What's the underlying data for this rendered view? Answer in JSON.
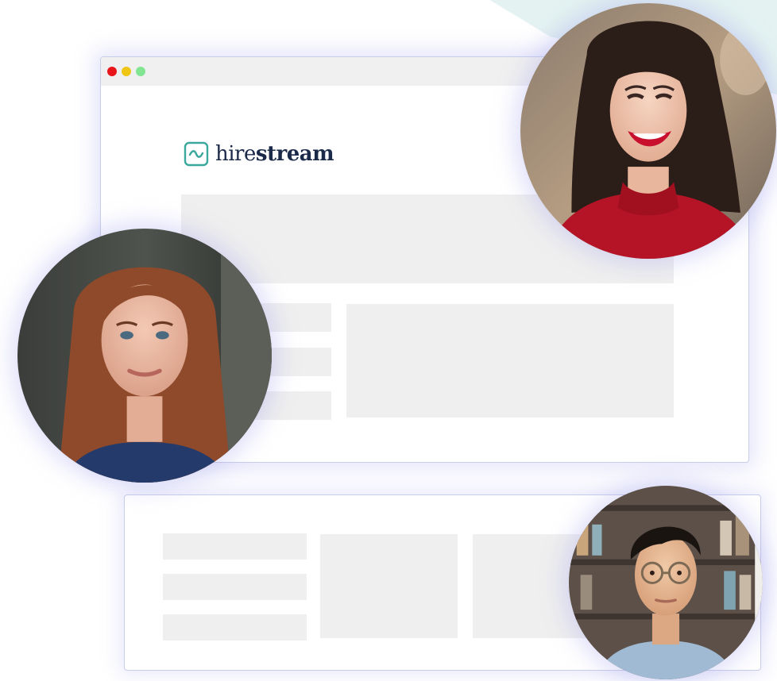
{
  "brand": {
    "name_light": "hire",
    "name_bold": "stream",
    "accent_color": "#3aa89c",
    "text_color": "#1c2a4a"
  },
  "window_controls": [
    "close",
    "minimize",
    "maximize"
  ],
  "avatars": [
    {
      "name": "avatar-smiling-woman-red-top"
    },
    {
      "name": "avatar-woman-auburn-hair"
    },
    {
      "name": "avatar-man-glasses"
    }
  ]
}
